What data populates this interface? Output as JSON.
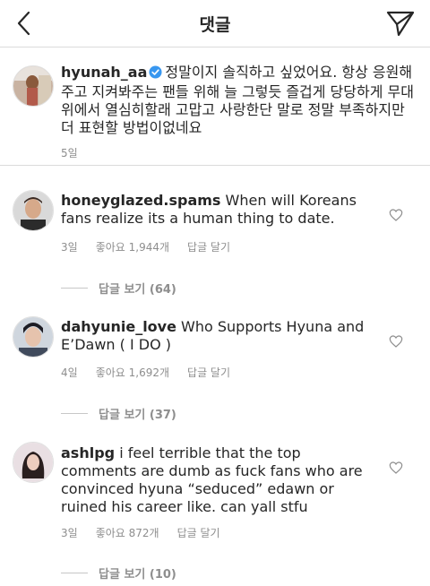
{
  "header": {
    "title": "댓글"
  },
  "caption": {
    "username": "hyunah_aa",
    "text": "정말이지 솔직하고 싶었어요. 항상 응원해주고 지켜봐주는 팬들 위해 늘 그렇듯 즐겁게 당당하게 무대위에서 열심히할래 고맙고 사랑한단 말로 정말 부족하지만 더 표현할 방법이없네요",
    "time": "5일"
  },
  "comments": [
    {
      "username": "honeyglazed.spams",
      "text": "When will Koreans fans realize its a human thing to date.",
      "time": "3일",
      "likes": "좋아요 1,944개",
      "reply_label": "답글 달기",
      "view_replies": "답글 보기 (64)"
    },
    {
      "username": "dahyunie_love",
      "text": "Who Supports  Hyuna and E’Dawn ( I DO )",
      "time": "4일",
      "likes": "좋아요 1,692개",
      "reply_label": "답글 달기",
      "view_replies": "답글 보기 (37)"
    },
    {
      "username": "ashlpg",
      "text": "i feel terrible that the top comments are dumb as fuck fans who are convinced hyuna “seduced” edawn or ruined his career like. can yall stfu",
      "time": "3일",
      "likes": "좋아요 872개",
      "reply_label": "답글 달기",
      "view_replies": "답글 보기 (10)"
    }
  ],
  "colors": {
    "text": "#262626",
    "muted": "#8e8e8e",
    "verified": "#3897f0",
    "divider": "#dbdbdb"
  },
  "icons": [
    "back-arrow-icon",
    "send-icon",
    "verified-badge-icon",
    "heart-icon"
  ]
}
